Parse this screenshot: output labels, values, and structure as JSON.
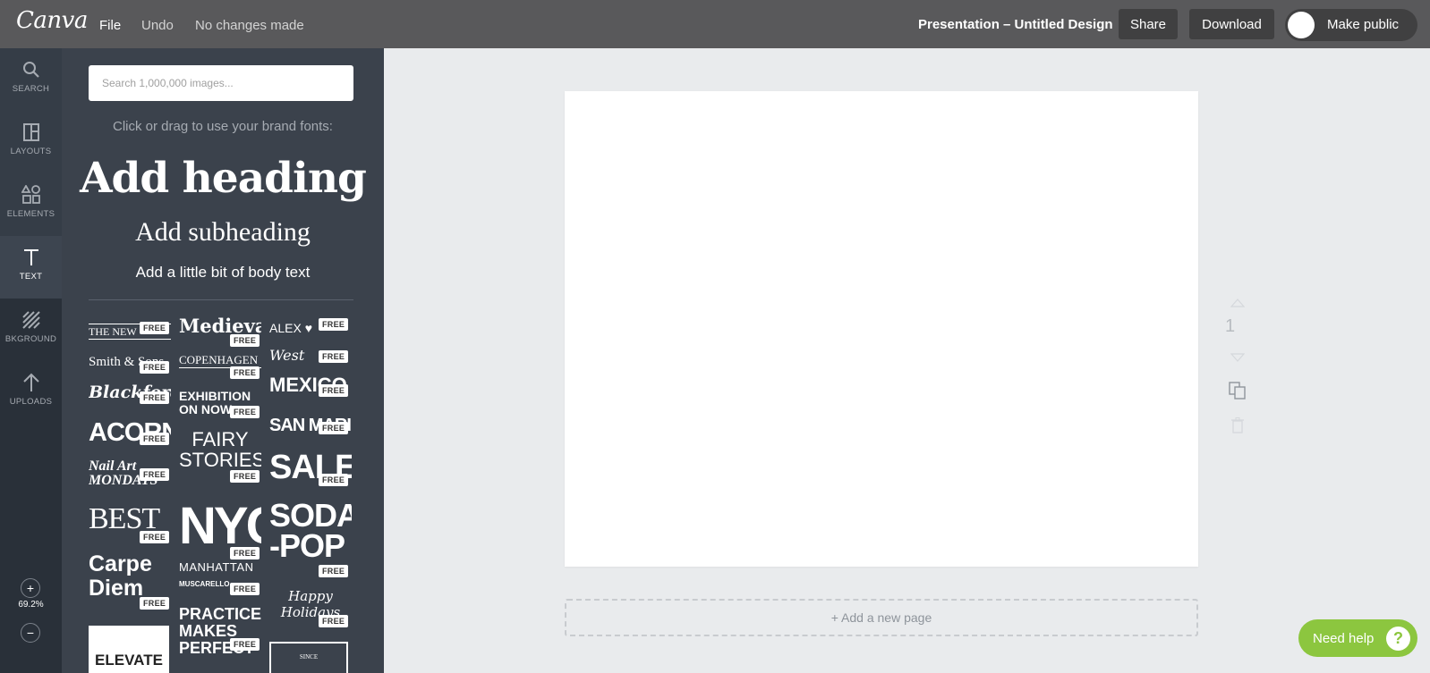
{
  "topbar": {
    "logo": "Canva",
    "file_label": "File",
    "undo_label": "Undo",
    "status": "No changes made",
    "document_title": "Presentation – Untitled Design",
    "share_label": "Share",
    "download_label": "Download",
    "make_public_label": "Make public"
  },
  "rail": {
    "items": [
      {
        "label": "SEARCH",
        "icon": "search-icon"
      },
      {
        "label": "LAYOUTS",
        "icon": "layouts-icon"
      },
      {
        "label": "ELEMENTS",
        "icon": "elements-icon"
      },
      {
        "label": "TEXT",
        "icon": "text-icon",
        "active": true
      },
      {
        "label": "BKGROUND",
        "icon": "background-icon"
      },
      {
        "label": "UPLOADS",
        "icon": "upload-icon"
      }
    ],
    "zoom_in": "+",
    "zoom_level": "69.2%",
    "zoom_out": "−"
  },
  "panel": {
    "search_placeholder": "Search 1,000,000 images...",
    "brand_hint": "Click or drag to use your brand fonts:",
    "add_heading": "Add heading",
    "add_subheading": "Add subheading",
    "add_body": "Add a little bit of body text",
    "free_badge": "FREE",
    "tiles": [
      {
        "text": "THE NEW"
      },
      {
        "text": "Medieval"
      },
      {
        "text": "ALEX ♥"
      },
      {
        "text": "Smith & Sons"
      },
      {
        "text": "COPENHAGEN"
      },
      {
        "text": "West"
      },
      {
        "text": "Blackford"
      },
      {
        "text": "EXHIBITION ON NOW"
      },
      {
        "text": "MEXICO"
      },
      {
        "text": "ACORN"
      },
      {
        "text": "FAIRY STORIES"
      },
      {
        "text": "SAN MARINO"
      },
      {
        "text": "Nail Art MONDAYS"
      },
      {
        "text": "NYC"
      },
      {
        "text": "SALE"
      },
      {
        "text": "BEST"
      },
      {
        "text": "MANHATTAN"
      },
      {
        "text": "SODA -POP"
      },
      {
        "text": "Carpe Diem"
      },
      {
        "text": "MUSCARELLO"
      },
      {
        "text": "Happy Holidays"
      },
      {
        "text": "ELEVATE"
      },
      {
        "text": "PRACTICE MAKES PERFECT"
      },
      {
        "text": "SINCE"
      }
    ]
  },
  "canvas": {
    "add_page_label": "+ Add a new page",
    "page_number": "1"
  },
  "help": {
    "label": "Need help",
    "icon": "?"
  },
  "colors": {
    "topbar": "#59595b",
    "rail": "#293039",
    "panel": "#3b424c",
    "workspace": "#e9ebed",
    "help": "#8cc63f"
  }
}
